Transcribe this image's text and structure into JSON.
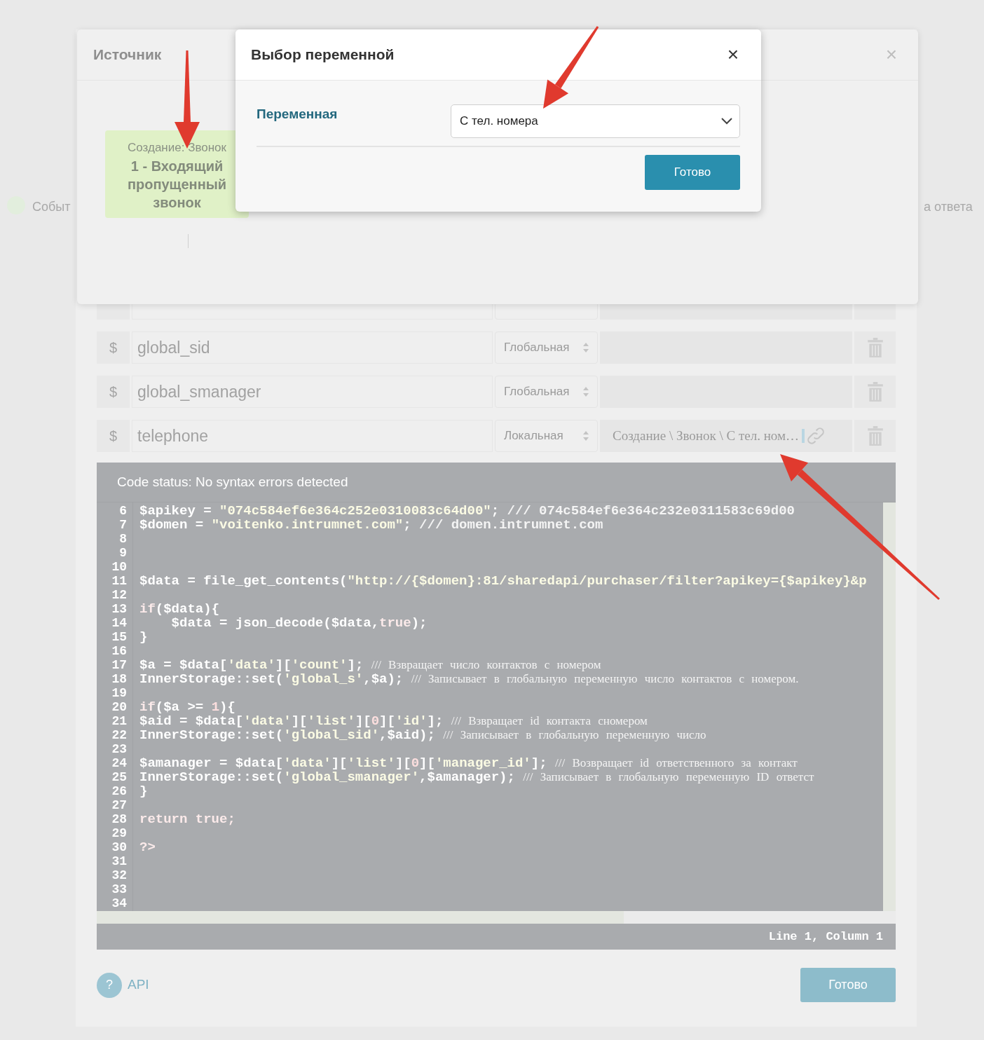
{
  "background_page": {
    "left_label": "Событ",
    "right_label": "а ответа"
  },
  "variables_dialog": {
    "variables": [
      {
        "name": "global_sid",
        "scope": "Глобальная"
      },
      {
        "name": "global_smanager",
        "scope": "Глобальная"
      },
      {
        "name": "telephone",
        "scope": "Локальная",
        "value": "Создание \\ Звонок \\ С тел. ном…"
      }
    ],
    "currency_sign": "$",
    "code_editor": {
      "status": "Code status: No syntax errors detected",
      "cursor": "Line 1, Column 1",
      "lines": [
        {
          "number": "6",
          "tokens": [
            {
              "kind": "plain",
              "text": "$apikey = "
            },
            {
              "kind": "string",
              "text": "\"074c584ef6e364c252e0310083c64d00\""
            },
            {
              "kind": "plain",
              "text": "; "
            },
            {
              "kind": "comment",
              "text": "/// 074c584ef6e364c232e0311583c69d00"
            }
          ]
        },
        {
          "number": "7",
          "tokens": [
            {
              "kind": "plain",
              "text": "$domen = "
            },
            {
              "kind": "string",
              "text": "\"voitenko.intrumnet.com\""
            },
            {
              "kind": "plain",
              "text": "; "
            },
            {
              "kind": "comment",
              "text": "/// domen.intrumnet.com"
            }
          ]
        },
        {
          "number": "8"
        },
        {
          "number": "9"
        },
        {
          "number": "10"
        },
        {
          "number": "11",
          "tokens": [
            {
              "kind": "plain",
              "text": "$data = file_get_contents("
            },
            {
              "kind": "string",
              "text": "\"http://{$domen}:81/sharedapi/purchaser/filter?apikey={$apikey}&p"
            }
          ]
        },
        {
          "number": "12"
        },
        {
          "number": "13",
          "tokens": [
            {
              "kind": "keyword",
              "text": "if"
            },
            {
              "kind": "plain",
              "text": "($data){"
            }
          ]
        },
        {
          "number": "14",
          "tokens": [
            {
              "kind": "plain",
              "text": "    $data = json_decode($data,"
            },
            {
              "kind": "keyword",
              "text": "true"
            },
            {
              "kind": "plain",
              "text": ");"
            }
          ]
        },
        {
          "number": "15",
          "tokens": [
            {
              "kind": "plain",
              "text": "}"
            }
          ]
        },
        {
          "number": "16"
        },
        {
          "number": "17",
          "tokens": [
            {
              "kind": "plain",
              "text": "$a = $data["
            },
            {
              "kind": "string",
              "text": "'data'"
            },
            {
              "kind": "plain",
              "text": "]["
            },
            {
              "kind": "string",
              "text": "'count'"
            },
            {
              "kind": "plain",
              "text": "]; "
            },
            {
              "kind": "note",
              "text": "/// Взвращает число контактов с номером"
            }
          ]
        },
        {
          "number": "18",
          "tokens": [
            {
              "kind": "plain",
              "text": "InnerStorage::set("
            },
            {
              "kind": "string",
              "text": "'global_s'"
            },
            {
              "kind": "plain",
              "text": ",$a); "
            },
            {
              "kind": "note",
              "text": "/// Записывает в глобальную переменную число контактов с номером."
            }
          ]
        },
        {
          "number": "19"
        },
        {
          "number": "20",
          "tokens": [
            {
              "kind": "keyword",
              "text": "if"
            },
            {
              "kind": "plain",
              "text": "($a >= "
            },
            {
              "kind": "number",
              "text": "1"
            },
            {
              "kind": "plain",
              "text": "){"
            }
          ]
        },
        {
          "number": "21",
          "tokens": [
            {
              "kind": "plain",
              "text": "$aid = $data["
            },
            {
              "kind": "string",
              "text": "'data'"
            },
            {
              "kind": "plain",
              "text": "]["
            },
            {
              "kind": "string",
              "text": "'list'"
            },
            {
              "kind": "plain",
              "text": "]["
            },
            {
              "kind": "number",
              "text": "0"
            },
            {
              "kind": "plain",
              "text": "]["
            },
            {
              "kind": "string",
              "text": "'id'"
            },
            {
              "kind": "plain",
              "text": "]; "
            },
            {
              "kind": "note",
              "text": "/// Взвращает id контакта сномером"
            }
          ]
        },
        {
          "number": "22",
          "tokens": [
            {
              "kind": "plain",
              "text": "InnerStorage::set("
            },
            {
              "kind": "string",
              "text": "'global_sid'"
            },
            {
              "kind": "plain",
              "text": ",$aid); "
            },
            {
              "kind": "note",
              "text": "/// Записывает в глобальную переменную число"
            }
          ]
        },
        {
          "number": "23"
        },
        {
          "number": "24",
          "tokens": [
            {
              "kind": "plain",
              "text": "$amanager = $data["
            },
            {
              "kind": "string",
              "text": "'data'"
            },
            {
              "kind": "plain",
              "text": "]["
            },
            {
              "kind": "string",
              "text": "'list'"
            },
            {
              "kind": "plain",
              "text": "]["
            },
            {
              "kind": "number",
              "text": "0"
            },
            {
              "kind": "plain",
              "text": "]["
            },
            {
              "kind": "string",
              "text": "'manager_id'"
            },
            {
              "kind": "plain",
              "text": "]; "
            },
            {
              "kind": "note",
              "text": "/// Возвращает id ответственного за контакт"
            }
          ]
        },
        {
          "number": "25",
          "tokens": [
            {
              "kind": "plain",
              "text": "InnerStorage::set("
            },
            {
              "kind": "string",
              "text": "'global_smanager'"
            },
            {
              "kind": "plain",
              "text": ",$amanager); "
            },
            {
              "kind": "note",
              "text": "/// Записывает в глобальную переменную ID ответст"
            }
          ]
        },
        {
          "number": "26",
          "tokens": [
            {
              "kind": "plain",
              "text": "}"
            }
          ]
        },
        {
          "number": "27"
        },
        {
          "number": "28",
          "tokens": [
            {
              "kind": "keyword",
              "text": "return true;"
            }
          ]
        },
        {
          "number": "29"
        },
        {
          "number": "30",
          "tokens": [
            {
              "kind": "keyword",
              "text": "?>"
            }
          ]
        },
        {
          "number": "31"
        },
        {
          "number": "32"
        },
        {
          "number": "33"
        },
        {
          "number": "34"
        }
      ]
    },
    "help_icon": "?",
    "help_link": "API",
    "done_button": "Готово"
  },
  "source_modal": {
    "title": "Источник",
    "close": "×",
    "card": {
      "caption": "Создание: Звонок",
      "title": "1 - Входящий пропущенный звонок"
    }
  },
  "variable_modal": {
    "title": "Выбор переменной",
    "close": "×",
    "field_label": "Переменная",
    "selected_value": "С тел. номера",
    "done_button": "Готово"
  }
}
